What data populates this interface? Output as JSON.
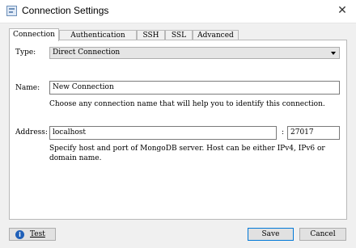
{
  "window": {
    "title": "Connection Settings",
    "close_glyph": "✕",
    "icon": "app-window-icon"
  },
  "tabs": [
    {
      "label": "Connection",
      "active": true
    },
    {
      "label": "Authentication",
      "active": false
    },
    {
      "label": "SSH",
      "active": false
    },
    {
      "label": "SSL",
      "active": false
    },
    {
      "label": "Advanced",
      "active": false
    }
  ],
  "connection": {
    "type_label": "Type:",
    "type_value": "Direct Connection",
    "name_label": "Name:",
    "name_value": "New Connection",
    "name_hint": "Choose any connection name that will help you to identify this connection.",
    "address_label": "Address:",
    "host_value": "localhost",
    "port_separator": ":",
    "port_value": "27017",
    "address_hint_line1": "Specify host and port of MongoDB server. Host can be either IPv4, IPv6 or",
    "address_hint_line2": "domain name."
  },
  "buttons": {
    "test_label": "Test",
    "test_icon_glyph": "i",
    "save_label": "Save",
    "cancel_label": "Cancel"
  }
}
